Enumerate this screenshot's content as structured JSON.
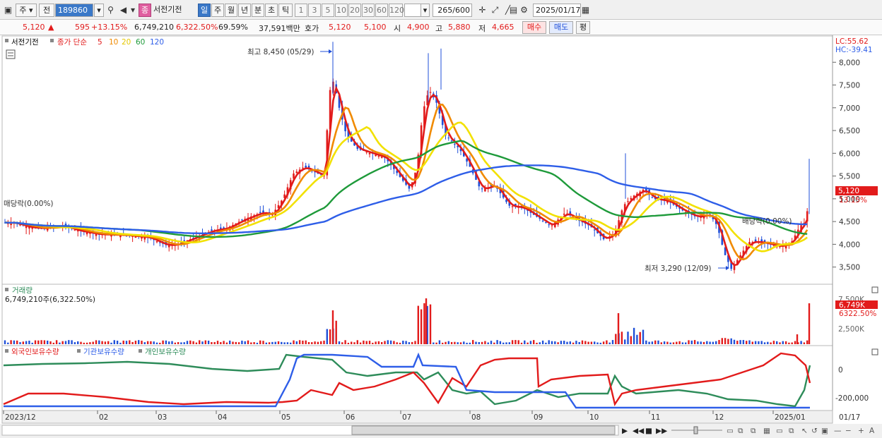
{
  "toolbar": {
    "market": "주",
    "range": "전",
    "code": "189860",
    "badge": "종",
    "name": "서전기전",
    "periods": [
      "일",
      "주",
      "월",
      "년",
      "분",
      "초",
      "틱"
    ],
    "minutes": [
      "1",
      "3",
      "5",
      "10",
      "20",
      "30",
      "60",
      "120"
    ],
    "count": "265",
    "count_total": "/600",
    "date": "2025/01/17"
  },
  "quote": {
    "price": "5,120",
    "up_arrow": "▲",
    "change": "595",
    "change_pct": "+13.15%",
    "volume": "6,749,210",
    "volume_pct": "6,322.50%",
    "turnover_pct": "69.59%",
    "amount": "37,591백만",
    "hoga_label": "호가",
    "bid": "5,120",
    "ask": "5,100",
    "open_label": "시",
    "open": "4,900",
    "high_label": "고",
    "high": "5,880",
    "low_label": "저",
    "low": "4,665",
    "buy_btn": "매수",
    "sell_btn": "매도",
    "flat_btn": "평"
  },
  "price_panel": {
    "legend_name": "서전기전",
    "legend_ma": "종가 단순",
    "ma_labels": [
      "5",
      "10",
      "20",
      "60",
      "120"
    ],
    "ma_colors": [
      "#e21b1b",
      "#f08a00",
      "#f2e100",
      "#1e9a3a",
      "#2e5ee8"
    ],
    "lc": "LC:55.62",
    "hc": "HC:-39.41",
    "high_note": "최고 8,450 (05/29)",
    "low_note": "최저 3,290 (12/09)",
    "left_flat": "매당락(0.00%)",
    "right_flat": "배당락(0.00%)",
    "current_price_tag": "5,120",
    "current_pct_tag": "13.15%",
    "y_ticks": [
      "8,000",
      "7,500",
      "7,000",
      "6,500",
      "6,000",
      "5,500",
      "5,000",
      "4,500",
      "4,000",
      "3,500"
    ]
  },
  "volume_panel": {
    "title": "거래량",
    "value": "6,749,210주(6,322.50%)",
    "tag": "6,749K",
    "tag_pct": "6322.50%",
    "y_ticks": [
      "7,500K",
      "2,500K"
    ]
  },
  "holdings_panel": {
    "legend": [
      "외국인보유수량",
      "기관보유수량",
      "개인보유수량"
    ],
    "colors": [
      "#e21b1b",
      "#2e5ee8",
      "#2e8c5a"
    ],
    "y_ticks": [
      "0",
      "-200,000"
    ]
  },
  "x_axis": {
    "labels": [
      "2023/12",
      "02",
      "03",
      "04",
      "05",
      "06",
      "07",
      "08",
      "09",
      "10",
      "11",
      "12",
      "2025/01"
    ],
    "right_label": "01/17"
  },
  "chart_data": {
    "type": "candlestick",
    "series": [
      {
        "name": "5",
        "color": "#e21b1b"
      },
      {
        "name": "10",
        "color": "#f08a00"
      },
      {
        "name": "20",
        "color": "#f2e100"
      },
      {
        "name": "60",
        "color": "#1e9a3a"
      },
      {
        "name": "120",
        "color": "#2e5ee8"
      }
    ],
    "price_points": [
      [
        "2023/12",
        4450
      ],
      [
        "02",
        4200
      ],
      [
        "03",
        3950
      ],
      [
        "04",
        4300
      ],
      [
        "05",
        5700
      ],
      [
        "05/29",
        7300
      ],
      [
        "06",
        6100
      ],
      [
        "07",
        5800
      ],
      [
        "07b",
        7300
      ],
      [
        "08",
        5600
      ],
      [
        "09",
        4300
      ],
      [
        "10",
        4200
      ],
      [
        "11",
        5000
      ],
      [
        "12",
        4500
      ],
      [
        "12/09",
        3400
      ],
      [
        "2025/01",
        3950
      ],
      [
        "01/17",
        5120
      ]
    ],
    "ylim": [
      3200,
      8500
    ]
  }
}
